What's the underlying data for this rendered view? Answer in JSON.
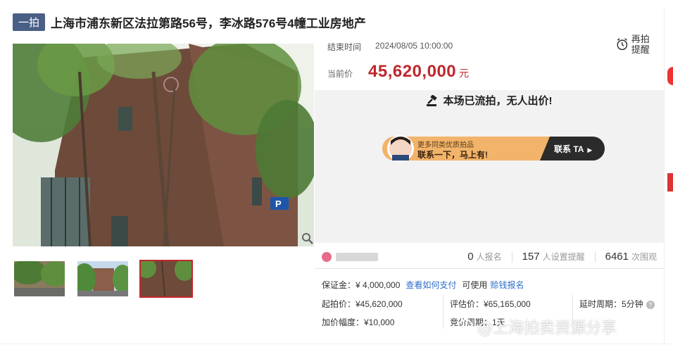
{
  "header": {
    "tag": "一拍",
    "title": "上海市浦东新区法拉第路56号，李冰路576号4幢工业房地产"
  },
  "auction": {
    "end_label": "结束时间",
    "end_time": "2024/08/05 10:00:00",
    "price_label": "当前价",
    "price": "45,620,000",
    "price_unit": "元",
    "remind_label": "再拍提醒",
    "status_text": "本场已流拍，无人出价!"
  },
  "banner": {
    "line1": "更多同类优质拍品",
    "line2": "联系一下，马上有!",
    "button": "联系 TA"
  },
  "stats": {
    "seller": "",
    "signups": "0",
    "signups_label": "人报名",
    "reminders": "157",
    "reminders_label": "人设置提醒",
    "views": "6461",
    "views_label": "次围观"
  },
  "deposit": {
    "label": "保证金：¥ 4,000,000",
    "how_to_pay": "查看如何支付",
    "usable": "可使用",
    "earn_link": "赊钱报名"
  },
  "params": {
    "start_price": "起拍价：¥45,620,000",
    "eval_price": "评估价：¥65,165,000",
    "delay_period": "延时周期：5分钟",
    "increment": "加价幅度：¥10,000",
    "bid_period": "竞价周期：1天"
  },
  "watermark": "@上海拍卖资源分享",
  "colors": {
    "accent_red": "#c0272d",
    "tag_blue": "#4a5f86",
    "link_blue": "#2d6ec9",
    "banner_orange": "#f2b46a",
    "banner_dark": "#2b2b2b"
  },
  "thumbnails": [
    {
      "name": "thumb-1",
      "active": false
    },
    {
      "name": "thumb-2",
      "active": false
    },
    {
      "name": "thumb-3",
      "active": true
    }
  ]
}
